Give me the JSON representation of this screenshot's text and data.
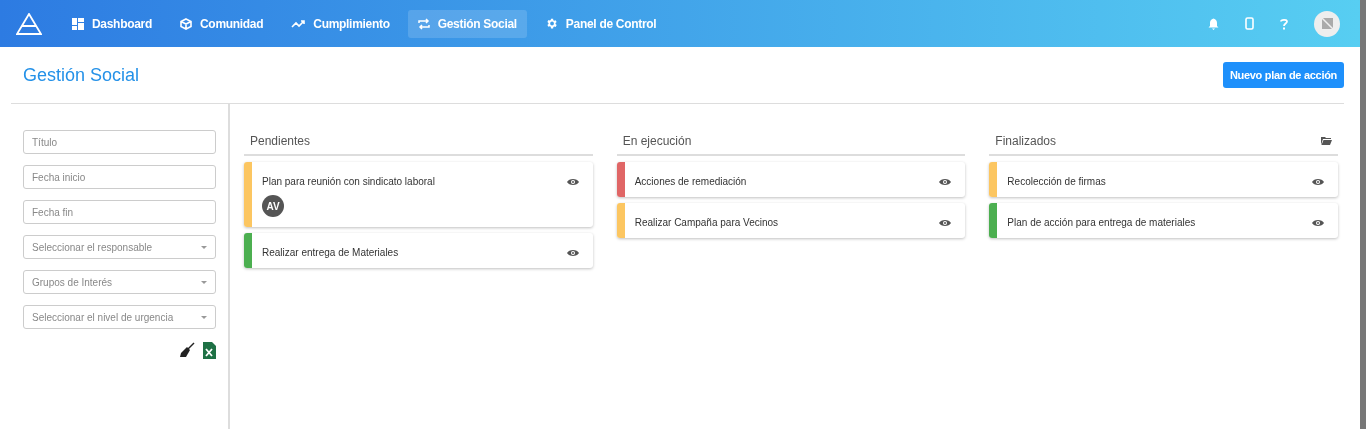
{
  "nav": {
    "items": [
      {
        "label": "Dashboard",
        "selected": false
      },
      {
        "label": "Comunidad",
        "selected": false
      },
      {
        "label": "Cumplimiento",
        "selected": false
      },
      {
        "label": "Gestión Social",
        "selected": true
      },
      {
        "label": "Panel de Control",
        "selected": false
      }
    ]
  },
  "page": {
    "title": "Gestión Social",
    "action": "Nuevo plan de acción"
  },
  "filters": [
    {
      "kind": "text",
      "placeholder": "Título"
    },
    {
      "kind": "text",
      "placeholder": "Fecha inicio"
    },
    {
      "kind": "text",
      "placeholder": "Fecha fin"
    },
    {
      "kind": "select",
      "placeholder": "Seleccionar el responsable"
    },
    {
      "kind": "select",
      "placeholder": "Grupos de Interés"
    },
    {
      "kind": "select",
      "placeholder": "Seleccionar el nivel de urgencia"
    }
  ],
  "columns": [
    {
      "title": "Pendientes",
      "cards": [
        {
          "title": "Plan para reunión con sindicato laboral",
          "color": "#fcc661",
          "assignee": "AV"
        },
        {
          "title": "Realizar entrega de Materiales",
          "color": "#4caf50"
        }
      ]
    },
    {
      "title": "En ejecución",
      "cards": [
        {
          "title": "Acciones de remediación",
          "color": "#e06666"
        },
        {
          "title": "Realizar Campaña para Vecinos",
          "color": "#fcc661"
        }
      ]
    },
    {
      "title": "Finalizados",
      "archive": true,
      "cards": [
        {
          "title": "Recolección de firmas",
          "color": "#fcc661"
        },
        {
          "title": "Plan de acción para entrega de materiales",
          "color": "#4caf50"
        }
      ]
    }
  ]
}
